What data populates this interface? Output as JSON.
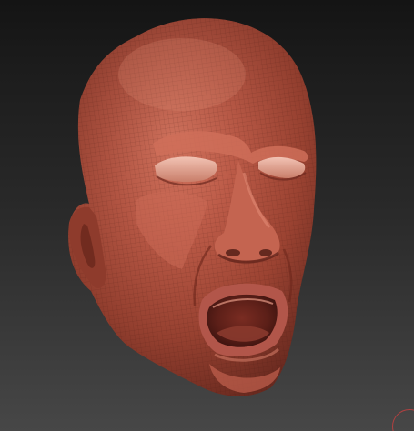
{
  "viewport": {
    "subject": "sculpted-head-mesh",
    "material_color": "#a84a3c",
    "background_top": "#141414",
    "background_bottom": "#474747",
    "polyframe": true
  },
  "gizmo": {
    "icon": "rotation-gizmo-icon",
    "color": "#b04040"
  }
}
